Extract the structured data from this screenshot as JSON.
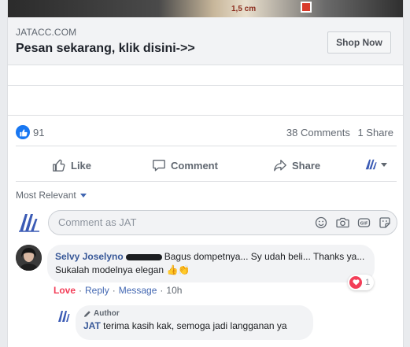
{
  "media": {
    "caption": "1,5 cm"
  },
  "link_preview": {
    "domain": "JATACC.COM",
    "title": "Pesan sekarang, klik disini->>",
    "cta_label": "Shop Now"
  },
  "stats": {
    "like_count": "91",
    "comments": "38 Comments",
    "shares": "1 Share"
  },
  "actions": [
    {
      "label": "Like",
      "icon": "thumbs-up-icon"
    },
    {
      "label": "Comment",
      "icon": "speech-bubble-icon"
    },
    {
      "label": "Share",
      "icon": "share-arrow-icon"
    }
  ],
  "sort": {
    "label": "Most Relevant"
  },
  "compose": {
    "placeholder": "Comment as JAT"
  },
  "comment": {
    "author": "Selvy Joselyno",
    "text": "Bagus dompetnya... Sy udah beli... Thanks ya... Sukalah modelnya elegan",
    "emoji": "👍👏",
    "reaction_count": "1",
    "meta": {
      "love": "Love",
      "reply": "Reply",
      "message": "Message",
      "time": "10h"
    }
  },
  "reply": {
    "badge": "Author",
    "author": "JAT",
    "text": "terima kasih kak, semoga jadi langganan ya"
  },
  "colors": {
    "brand_blue": "#1877f2",
    "link_blue": "#385898",
    "love_red": "#f33e58"
  }
}
